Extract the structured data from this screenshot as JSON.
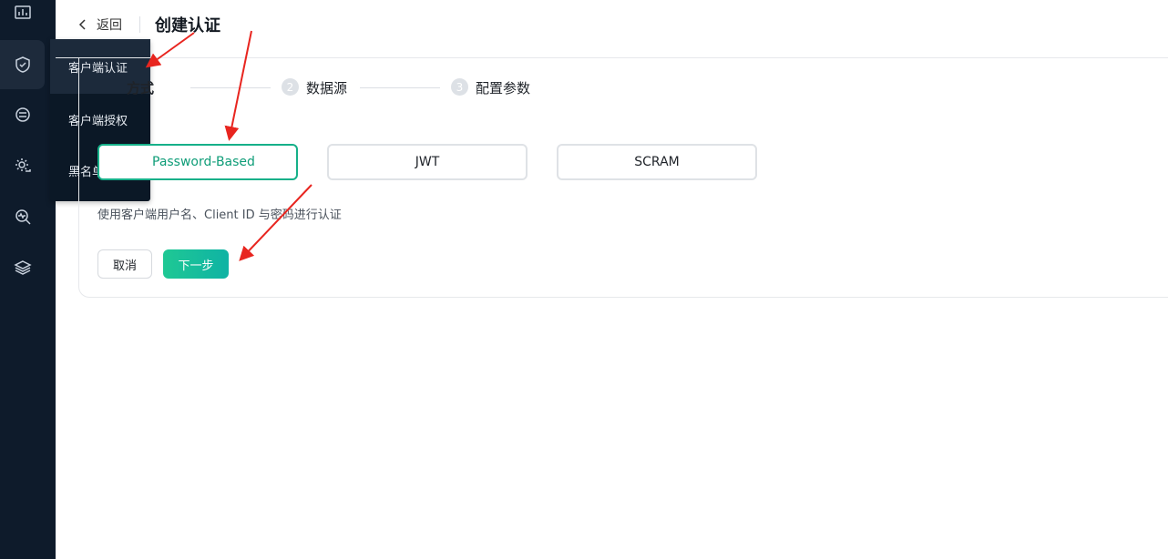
{
  "header": {
    "back_label": "返回",
    "title": "创建认证"
  },
  "rail": {
    "icons": [
      "dashboard-icon",
      "shield-icon",
      "clients-icon",
      "gear-cloud-icon",
      "diagnose-icon",
      "layers-icon"
    ]
  },
  "flyout": {
    "items": [
      {
        "label": "客户端认证",
        "active": true
      },
      {
        "label": "客户端授权"
      },
      {
        "label": "黑名单"
      }
    ]
  },
  "steps": [
    {
      "label": "方式",
      "state": "current"
    },
    {
      "number": "2",
      "label": "数据源"
    },
    {
      "number": "3",
      "label": "配置参数"
    }
  ],
  "mechanisms": [
    {
      "label": "Password-Based",
      "selected": true
    },
    {
      "label": "JWT"
    },
    {
      "label": "SCRAM"
    }
  ],
  "description": "使用客户端用户名、Client ID 与密码进行认证",
  "actions": {
    "cancel": "取消",
    "next": "下一步"
  },
  "colors": {
    "rail_bg": "#0e1b2b",
    "accent": "#16b089",
    "annotation_arrow": "#e8251f"
  }
}
